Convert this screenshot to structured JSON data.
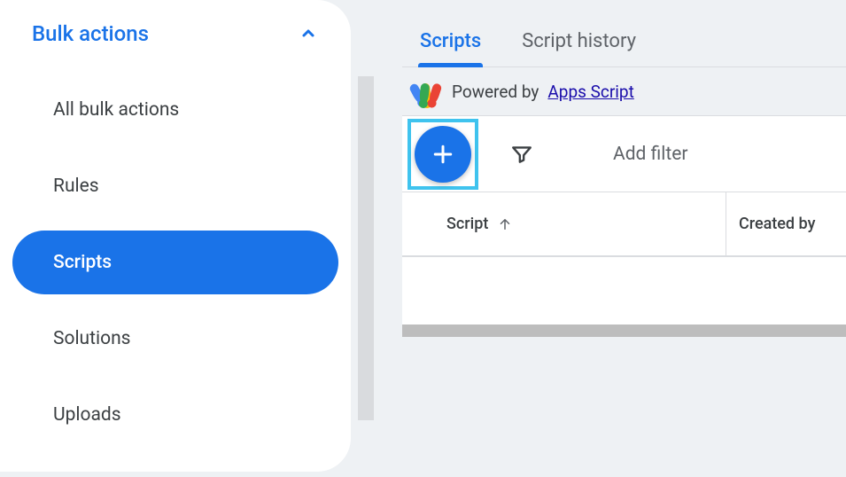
{
  "sidebar": {
    "title": "Bulk actions",
    "items": [
      {
        "label": "All bulk actions",
        "active": false
      },
      {
        "label": "Rules",
        "active": false
      },
      {
        "label": "Scripts",
        "active": true
      },
      {
        "label": "Solutions",
        "active": false
      },
      {
        "label": "Uploads",
        "active": false
      }
    ]
  },
  "tabs": {
    "scripts": "Scripts",
    "history": "Script history"
  },
  "powered": {
    "prefix": "Powered by ",
    "link": "Apps Script"
  },
  "toolbar": {
    "add_filter": "Add filter"
  },
  "table": {
    "col_script": "Script",
    "col_created": "Created by"
  }
}
